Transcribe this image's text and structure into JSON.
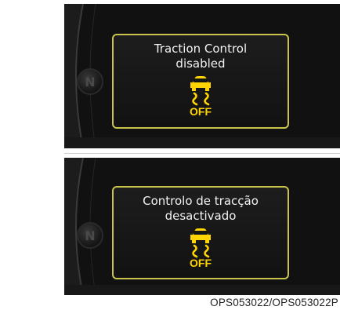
{
  "panels": [
    {
      "message_line1": "Traction Control",
      "message_line2": "disabled",
      "indicator_label": "OFF",
      "gear_label": "N"
    },
    {
      "message_line1": "Controlo de tracção",
      "message_line2": "desactivado",
      "indicator_label": "OFF",
      "gear_label": "N"
    }
  ],
  "caption": "OPS053022/OPS053022P",
  "colors": {
    "frame": "#c8c34a",
    "indicator": "#ffd400",
    "text": "#f2f2f2",
    "background": "#111111"
  },
  "icons": [
    "traction-control-off-icon",
    "gear-n-icon"
  ]
}
